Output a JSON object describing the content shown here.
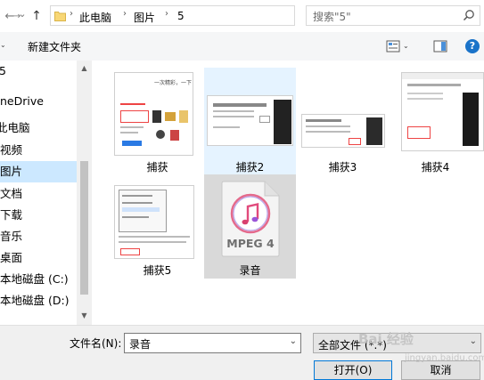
{
  "nav_buttons": {
    "back": "←",
    "forward": "→",
    "dropdown": "⌄",
    "up": "↑",
    "refresh": "↻"
  },
  "address": {
    "crumbs": [
      "此电脑",
      "图片",
      "5"
    ],
    "separator": "›"
  },
  "search": {
    "value": "搜索\"5\""
  },
  "toolbar": {
    "new_folder": "新建文件夹",
    "help": "?"
  },
  "nav": {
    "items": [
      {
        "label": "5"
      },
      {
        "label": "neDrive"
      },
      {
        "label": "此电脑"
      },
      {
        "label": "视频"
      },
      {
        "label": "图片"
      },
      {
        "label": "文档"
      },
      {
        "label": "下载"
      },
      {
        "label": "音乐"
      },
      {
        "label": "桌面"
      },
      {
        "label": "本地磁盘 (C:)"
      },
      {
        "label": "本地磁盘 (D:)"
      }
    ],
    "selected_index": 4
  },
  "files": [
    {
      "name": "捕获"
    },
    {
      "name": "捕获2"
    },
    {
      "name": "捕获3"
    },
    {
      "name": "捕获4"
    },
    {
      "name": "捕获5"
    },
    {
      "name": "录音",
      "icon_text": "MPEG 4"
    }
  ],
  "thumb_text": {
    "t1": "一次精彩，一下"
  },
  "bottom": {
    "filename_label": "文件名(N):",
    "filename_value": "录音",
    "filetype_value": "全部文件 (*.*)",
    "open_label": "打开(O)",
    "cancel_label": "取消"
  },
  "watermark": {
    "main": "Bai 经验",
    "sub": "jingyan.baidu.com"
  },
  "colors": {
    "accent": "#0078d7",
    "selected_nav": "#cce8ff",
    "hover_tile": "#e5f3ff",
    "selected_tile": "#d9d9d9"
  }
}
